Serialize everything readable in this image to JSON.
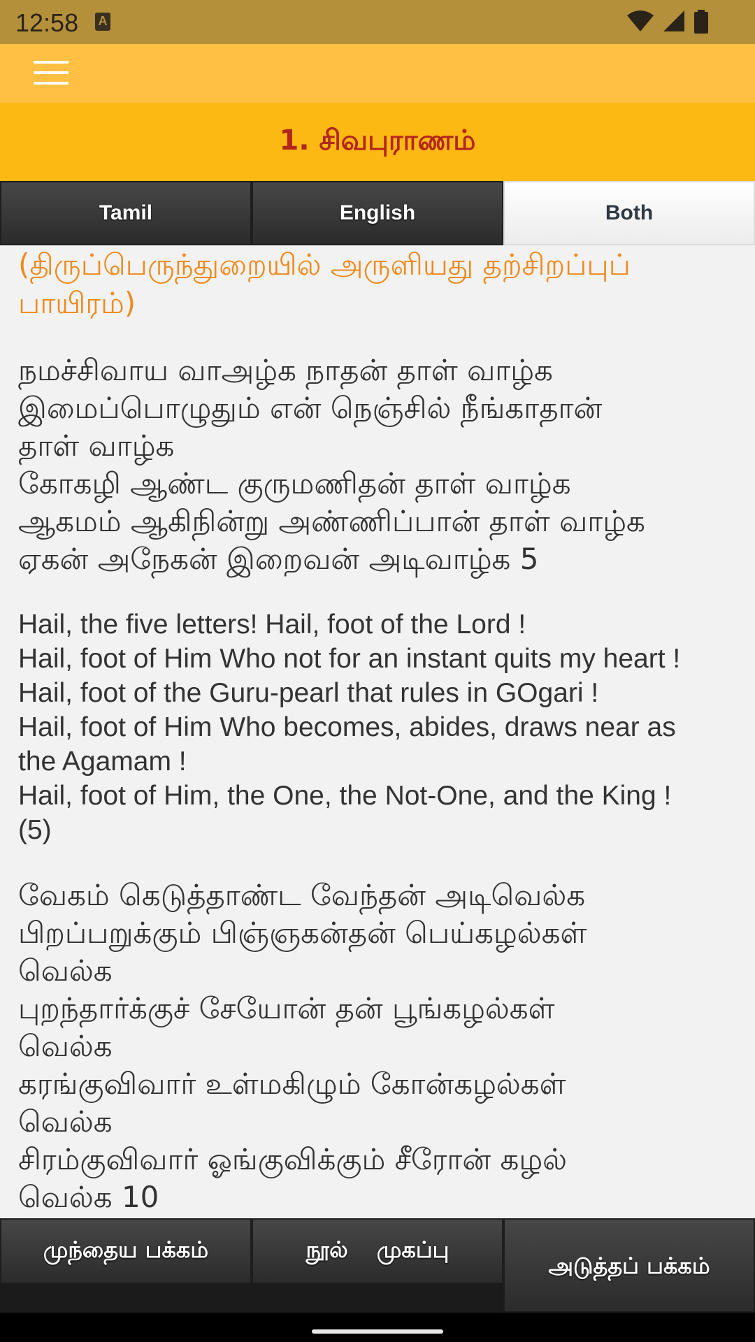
{
  "status_bar": {
    "time": "12:58",
    "notification_badge": "A",
    "icons": [
      "wifi-icon",
      "cell-signal-icon",
      "battery-icon"
    ]
  },
  "app_bar": {
    "menu_icon": "hamburger-menu-icon"
  },
  "title": "1. சிவபுராணம்",
  "tabs": [
    {
      "label": "Tamil",
      "active": false
    },
    {
      "label": "English",
      "active": false
    },
    {
      "label": "Both",
      "active": true
    }
  ],
  "content": {
    "subtitle_line1": "(திருப்பெருந்துறையில் அருளியது தற்சிறப்புப்",
    "subtitle_line2": "பாயிரம்)",
    "stanza1_tamil": [
      "நமச்சிவாய வாஅழ்க நாதன் தாள் வாழ்க",
      "இமைப்பொழுதும் என் நெஞ்சில் நீங்காதான்",
      "தாள் வாழ்க",
      "கோகழி ஆண்ட குருமணிதன் தாள் வாழ்க",
      "ஆகமம் ஆகிநின்று அண்ணிப்பான் தாள் வாழ்க",
      "ஏகன் அநேகன் இறைவன் அடிவாழ்க 5"
    ],
    "stanza1_english": [
      "Hail, the five letters! Hail, foot of the Lord !",
      "Hail, foot of Him Who not for an instant quits my heart !",
      "Hail, foot of the Guru-pearl that rules in GOgari !",
      "Hail, foot of Him Who becomes, abides, draws near as",
      "the Agamam !",
      "Hail, foot of Him, the One, the Not-One, and the King !",
      "(5)"
    ],
    "stanza2_tamil": [
      "வேகம் கெடுத்தாண்ட வேந்தன் அடிவெல்க",
      "பிறப்பறுக்கும் பிஞ்ஞகன்தன் பெய்கழல்கள்",
      "வெல்க",
      "புறந்தார்க்குச் சேயோன் தன் பூங்கழல்கள்",
      "வெல்க",
      "கரங்குவிவார் உள்மகிழும் கோன்கழல்கள்",
      "வெல்க",
      "சிரம்குவிவார் ஓங்குவிக்கும் சீரோன் கழல்",
      "வெல்க 10"
    ]
  },
  "bottom_nav": {
    "prev_label": "முந்தைய பக்கம்",
    "home_label": "நூல் முகப்பு",
    "next_label": "அடுத்தப் பக்கம்"
  },
  "colors": {
    "status_bar": "#b5903a",
    "app_bar": "#ffc043",
    "title_bar": "#fdb913",
    "title_text": "#b3271a",
    "subtitle_text": "#f08a1c"
  }
}
